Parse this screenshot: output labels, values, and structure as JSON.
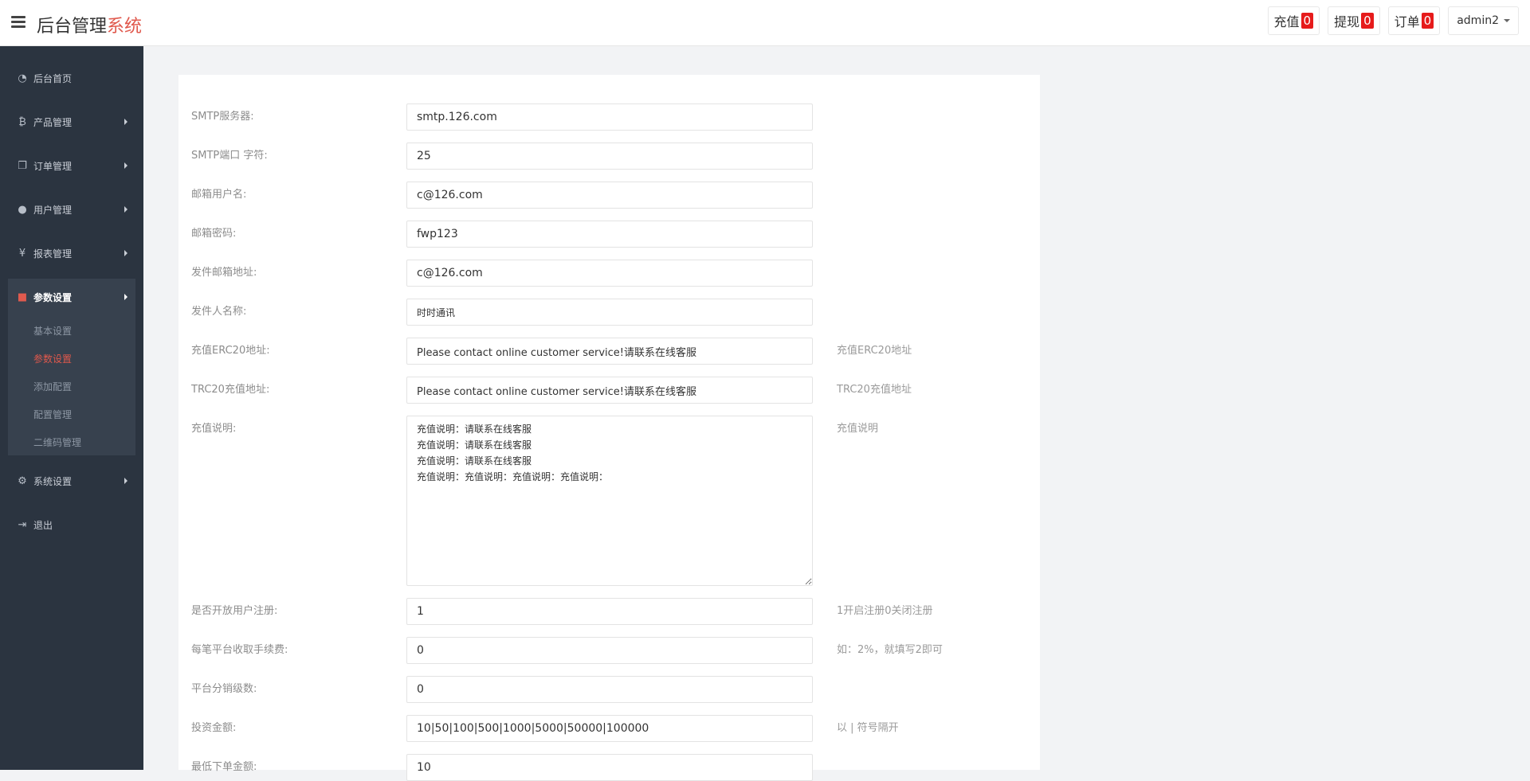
{
  "header": {
    "brand_main": "后台管理",
    "brand_accent": "系统",
    "recharge_label": "充值",
    "recharge_count": "0",
    "withdraw_label": "提现",
    "withdraw_count": "0",
    "order_label": "订单",
    "order_count": "0",
    "username": "admin2"
  },
  "sidebar": {
    "items": [
      {
        "label": "后台首页",
        "icon": "dashboard-icon"
      },
      {
        "label": "产品管理",
        "icon": "bitcoin-icon"
      },
      {
        "label": "订单管理",
        "icon": "copy-icon"
      },
      {
        "label": "用户管理",
        "icon": "user-icon"
      },
      {
        "label": "报表管理",
        "icon": "yen-icon"
      },
      {
        "label": "参数设置",
        "icon": "files-icon"
      },
      {
        "label": "系统设置",
        "icon": "gears-icon"
      },
      {
        "label": "退出",
        "icon": "sign-out-icon"
      }
    ],
    "sub_items": [
      "基本设置",
      "参数设置",
      "添加配置",
      "配置管理",
      "二维码管理"
    ]
  },
  "form": {
    "fields": [
      {
        "label": "SMTP服务器:",
        "value": "smtp.126.com",
        "hint": ""
      },
      {
        "label": "SMTP端口 字符:",
        "value": "25",
        "hint": ""
      },
      {
        "label": "邮箱用户名:",
        "value": "c@126.com",
        "hint": ""
      },
      {
        "label": "邮箱密码:",
        "value": "fwp123",
        "hint": ""
      },
      {
        "label": "发件邮箱地址:",
        "value": "c@126.com",
        "hint": ""
      },
      {
        "label": "发件人名称:",
        "value": "时时通讯",
        "hint": ""
      },
      {
        "label": "充值ERC20地址:",
        "value": "Please contact online customer service!请联系在线客服",
        "hint": "充值ERC20地址"
      },
      {
        "label": "TRC20充值地址:",
        "value": "Please contact online customer service!请联系在线客服",
        "hint": "TRC20充值地址"
      },
      {
        "label": "充值说明:",
        "value": "充值说明：请联系在线客服\n充值说明：请联系在线客服\n充值说明：请联系在线客服\n充值说明：充值说明：充值说明：充值说明：",
        "hint": "充值说明"
      },
      {
        "label": "是否开放用户注册:",
        "value": "1",
        "hint": "1开启注册0关闭注册"
      },
      {
        "label": "每笔平台收取手续费:",
        "value": "0",
        "hint": "如：2%，就填写2即可"
      },
      {
        "label": "平台分销级数:",
        "value": "0",
        "hint": ""
      },
      {
        "label": "投资金额:",
        "value": "10|50|100|500|1000|5000|50000|100000",
        "hint": "以 | 符号隔开"
      },
      {
        "label": "最低下单金额:",
        "value": "10",
        "hint": ""
      }
    ]
  },
  "colors": {
    "sidebar_bg": "#2b3440",
    "accent": "#e0584c",
    "badge": "#e61b1b"
  }
}
